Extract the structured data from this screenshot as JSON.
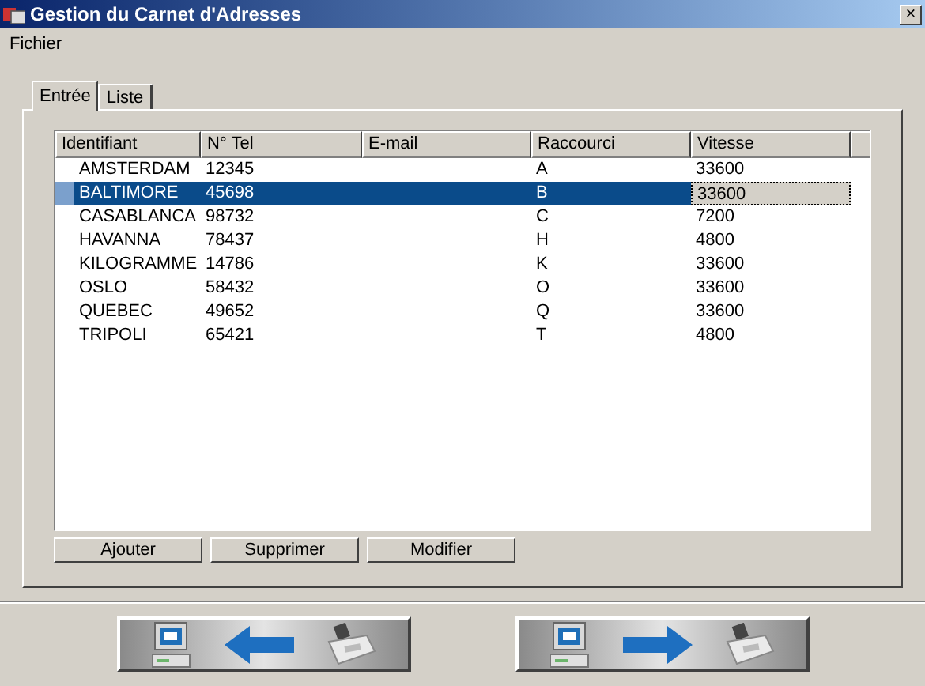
{
  "window": {
    "title": "Gestion du Carnet d'Adresses",
    "close": "×"
  },
  "menu": [
    "Fichier"
  ],
  "tabs": [
    {
      "label": "Entrée",
      "selected": true
    },
    {
      "label": "Liste",
      "selected": false
    }
  ],
  "table": {
    "columns": [
      "Identifiant",
      "N° Tel",
      "E-mail",
      "Raccourci",
      "Vitesse"
    ],
    "rows": [
      {
        "cells": [
          "AMSTERDAM",
          "12345",
          "",
          "A",
          "33600"
        ],
        "selected": false
      },
      {
        "cells": [
          "BALTIMORE",
          "45698",
          "",
          "B",
          "33600"
        ],
        "selected": true
      },
      {
        "cells": [
          "CASABLANCA",
          "98732",
          "",
          "C",
          "7200"
        ],
        "selected": false
      },
      {
        "cells": [
          "HAVANNA",
          "78437",
          "",
          "H",
          "4800"
        ],
        "selected": false
      },
      {
        "cells": [
          "KILOGRAMME",
          "14786",
          "",
          "K",
          "33600"
        ],
        "selected": false
      },
      {
        "cells": [
          "OSLO",
          "58432",
          "",
          "O",
          "33600"
        ],
        "selected": false
      },
      {
        "cells": [
          "QUEBEC",
          "49652",
          "",
          "Q",
          "33600"
        ],
        "selected": false
      },
      {
        "cells": [
          "TRIPOLI",
          "65421",
          "",
          "T",
          "4800"
        ],
        "selected": false
      }
    ]
  },
  "buttons": [
    "Ajouter",
    "Supprimer",
    "Modifier"
  ],
  "transfer_buttons": [
    {
      "kind": "left"
    },
    {
      "kind": "right"
    }
  ]
}
